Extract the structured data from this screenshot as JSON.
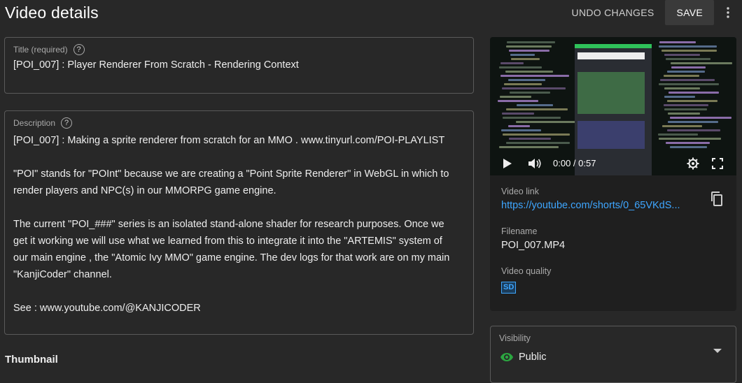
{
  "header": {
    "title": "Video details",
    "undo_label": "UNDO CHANGES",
    "save_label": "SAVE"
  },
  "title_field": {
    "label": "Title (required)",
    "value": "[POI_007] : Player Renderer From Scratch - Rendering Context"
  },
  "description_field": {
    "label": "Description",
    "lines": [
      "[POI_007] : Making a sprite renderer from scratch for an MMO . www.tinyurl.com/POI-PLAYLIST",
      "",
      "\"POI\" stands for \"POInt\" because we are creating a \"Point Sprite Renderer\" in WebGL in which to",
      "render players and NPC(s) in our MMORPG game engine.",
      "",
      "The current \"POI_###\" series is an isolated stand-alone shader for research purposes. Once we",
      "get it working we will use what we learned from this to integrate it into the \"ARTEMIS\" system of",
      "our main engine , the \"Atomic Ivy MMO\" game engine. The dev logs for that work are on my main",
      "\"KanjiCoder\" channel.",
      "",
      "See : www.youtube.com/@KANJICODER"
    ]
  },
  "thumbnail": {
    "heading": "Thumbnail"
  },
  "video": {
    "time": "0:00 / 0:57",
    "icons": [
      "play-icon",
      "volume-icon",
      "settings-icon",
      "fullscreen-icon"
    ]
  },
  "video_info": {
    "link_label": "Video link",
    "link_value": "https://youtube.com/shorts/0_65VKdS...",
    "filename_label": "Filename",
    "filename_value": "POI_007.MP4",
    "quality_label": "Video quality",
    "quality_badge": "SD"
  },
  "visibility": {
    "label": "Visibility",
    "value": "Public"
  },
  "colors": {
    "background": "#282828",
    "link": "#3ea6ff",
    "public_green": "#2ba640"
  }
}
